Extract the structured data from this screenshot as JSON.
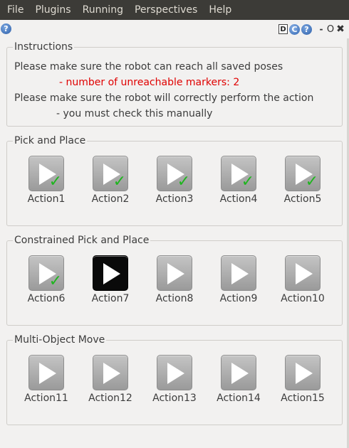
{
  "menubar": {
    "items": [
      "File",
      "Plugins",
      "Running",
      "Perspectives",
      "Help"
    ]
  },
  "toolbar": {
    "help_glyph": "?",
    "icons": [
      "D",
      "C",
      "?",
      "-",
      "O",
      "✖"
    ]
  },
  "instructions": {
    "title": "Instructions",
    "line1": "Please make sure the robot can reach all saved poses",
    "line2": "- number of unreachable markers: 2",
    "line3": "Please make sure the robot will correctly perform the action",
    "line4": "- you must check this manually"
  },
  "groups": [
    {
      "title": "Pick and Place",
      "actions": [
        {
          "label": "Action1",
          "checked": true,
          "active": false
        },
        {
          "label": "Action2",
          "checked": true,
          "active": false
        },
        {
          "label": "Action3",
          "checked": true,
          "active": false
        },
        {
          "label": "Action4",
          "checked": true,
          "active": false
        },
        {
          "label": "Action5",
          "checked": true,
          "active": false
        }
      ]
    },
    {
      "title": "Constrained Pick and Place",
      "actions": [
        {
          "label": "Action6",
          "checked": true,
          "active": false
        },
        {
          "label": "Action7",
          "checked": false,
          "active": true
        },
        {
          "label": "Action8",
          "checked": false,
          "active": false
        },
        {
          "label": "Action9",
          "checked": false,
          "active": false
        },
        {
          "label": "Action10",
          "checked": false,
          "active": false
        }
      ]
    },
    {
      "title": "Multi-Object Move",
      "actions": [
        {
          "label": "Action11",
          "checked": false,
          "active": false
        },
        {
          "label": "Action12",
          "checked": false,
          "active": false
        },
        {
          "label": "Action13",
          "checked": false,
          "active": false
        },
        {
          "label": "Action14",
          "checked": false,
          "active": false
        },
        {
          "label": "Action15",
          "checked": false,
          "active": false
        }
      ]
    }
  ],
  "colors": {
    "menubar_bg": "#3c3b37",
    "warning_text": "#e00000",
    "check_green": "#1fb51f",
    "active_button": "#0a0a0a"
  },
  "check_glyph": "✓"
}
